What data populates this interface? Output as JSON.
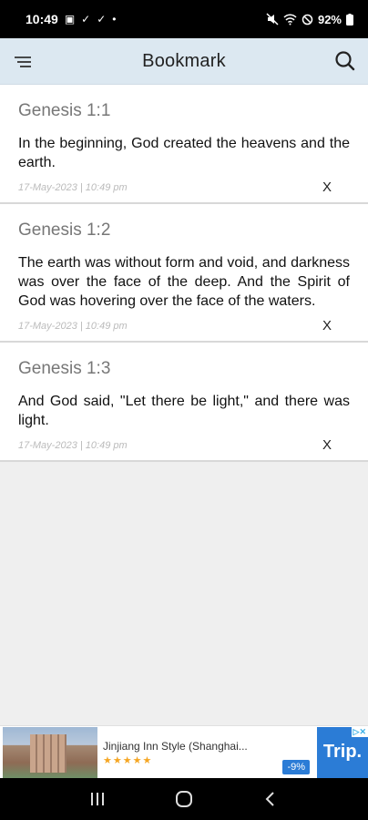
{
  "status_bar": {
    "time": "10:49",
    "battery": "92%",
    "left_icons": [
      "gallery-icon",
      "check-icon",
      "check-icon",
      "dot-icon"
    ],
    "right_icons": [
      "mute-icon",
      "wifi-icon",
      "no-sign-icon",
      "battery-icon"
    ]
  },
  "app_bar": {
    "title": "Bookmark",
    "menu_icon": "menu-icon",
    "search_icon": "search-icon"
  },
  "bookmarks": [
    {
      "reference": "Genesis 1:1",
      "text": "In the beginning, God created the heavens and the earth.",
      "date": "17-May-2023 | 10:49 pm",
      "remove_label": "X"
    },
    {
      "reference": "Genesis 1:2",
      "text": "The earth was without form and void, and darkness was over the face of the deep. And the Spirit of God was hovering over the face of the waters.",
      "date": "17-May-2023 | 10:49 pm",
      "remove_label": "X"
    },
    {
      "reference": "Genesis 1:3",
      "text": "And God said, \"Let there be light,\" and there was light.",
      "date": "17-May-2023 | 10:49 pm",
      "remove_label": "X"
    }
  ],
  "ad": {
    "hotel_name": "Jinjiang Inn Style (Shanghai...",
    "stars": "★★★★★",
    "discount": "-9%",
    "brand": "Trip."
  },
  "colors": {
    "app_bar_bg": "#dce8f1",
    "page_bg": "#efefef",
    "ad_brand": "#2b7cd6"
  }
}
